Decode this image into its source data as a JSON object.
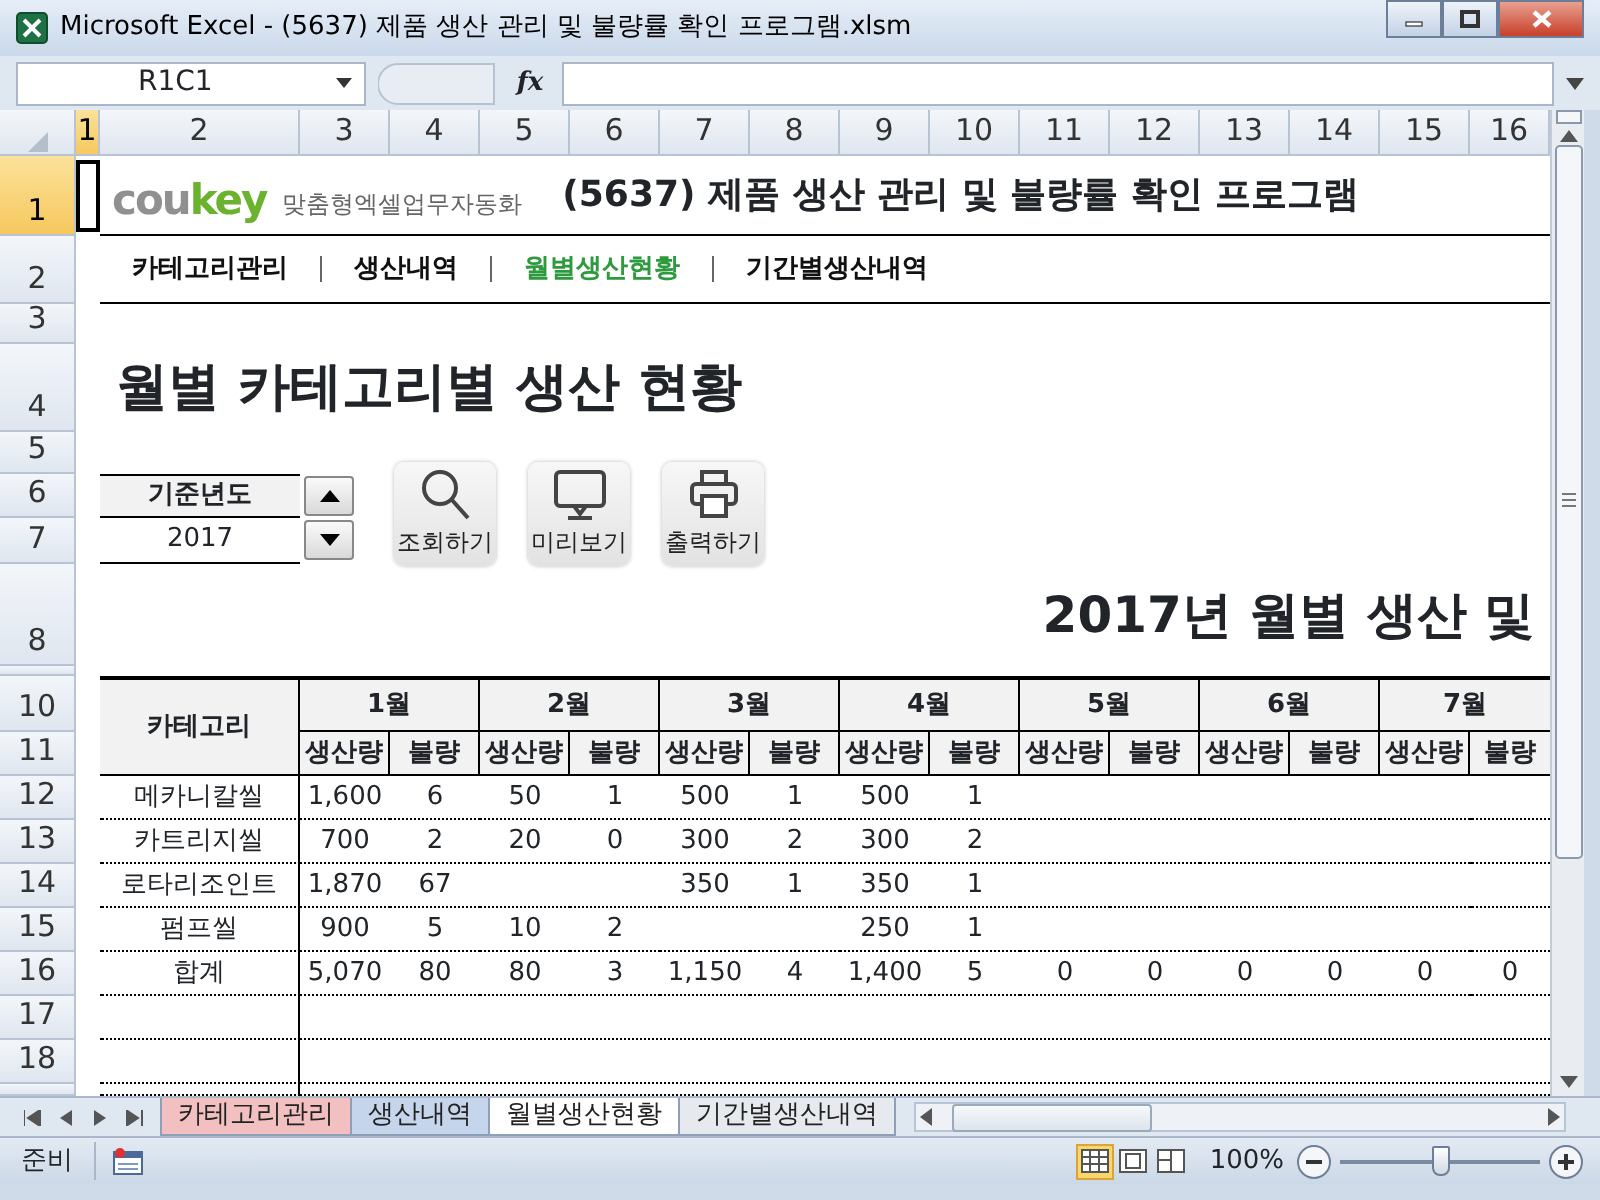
{
  "window": {
    "title": "Microsoft Excel - (5637) 제품 생산 관리 및 불량률 확인 프로그램.xlsm"
  },
  "formula_bar": {
    "name_box": "R1C1",
    "fx_label": "fx"
  },
  "column_headers": [
    {
      "label": "1",
      "selected": true
    },
    {
      "label": "2",
      "selected": false
    },
    {
      "label": "3",
      "selected": false
    },
    {
      "label": "4",
      "selected": false
    },
    {
      "label": "5",
      "selected": false
    },
    {
      "label": "6",
      "selected": false
    },
    {
      "label": "7",
      "selected": false
    },
    {
      "label": "8",
      "selected": false
    },
    {
      "label": "9",
      "selected": false
    },
    {
      "label": "10",
      "selected": false
    },
    {
      "label": "11",
      "selected": false
    },
    {
      "label": "12",
      "selected": false
    },
    {
      "label": "13",
      "selected": false
    },
    {
      "label": "14",
      "selected": false
    },
    {
      "label": "15",
      "selected": false
    },
    {
      "label": "16",
      "selected": false
    }
  ],
  "row_headers": [
    {
      "label": "1",
      "selected": true
    },
    {
      "label": "2",
      "selected": false
    },
    {
      "label": "3",
      "selected": false
    },
    {
      "label": "4",
      "selected": false
    },
    {
      "label": "5",
      "selected": false
    },
    {
      "label": "6",
      "selected": false
    },
    {
      "label": "7",
      "selected": false
    },
    {
      "label": "8",
      "selected": false
    },
    {
      "label": "10",
      "selected": false
    },
    {
      "label": "11",
      "selected": false
    },
    {
      "label": "12",
      "selected": false
    },
    {
      "label": "13",
      "selected": false
    },
    {
      "label": "14",
      "selected": false
    },
    {
      "label": "15",
      "selected": false
    },
    {
      "label": "16",
      "selected": false
    },
    {
      "label": "17",
      "selected": false
    },
    {
      "label": "18",
      "selected": false
    }
  ],
  "logo": {
    "brand": [
      "cou",
      "key"
    ],
    "tagline": "맞춤형엑셀업무자동화"
  },
  "program_title": "(5637) 제품 생산 관리 및 불량률 확인 프로그램",
  "nav": [
    {
      "label": "카테고리관리",
      "selected": false
    },
    {
      "label": "생산내역",
      "selected": false
    },
    {
      "label": "월별생산현황",
      "selected": true
    },
    {
      "label": "기간별생산내역",
      "selected": false
    }
  ],
  "heading": "월별 카테고리별 생산 현황",
  "year_picker": {
    "label": "기준년도",
    "value": "2017"
  },
  "actions": [
    {
      "kind": "search",
      "label": "조회하기"
    },
    {
      "kind": "preview",
      "label": "미리보기"
    },
    {
      "kind": "print",
      "label": "출력하기"
    }
  ],
  "report_title": "2017년 월별 생산 및",
  "table": {
    "category_header": "카테고리",
    "months": [
      {
        "label": "1월",
        "columns": [
          "생산량",
          "불량"
        ]
      },
      {
        "label": "2월",
        "columns": [
          "생산량",
          "불량"
        ]
      },
      {
        "label": "3월",
        "columns": [
          "생산량",
          "불량"
        ]
      },
      {
        "label": "4월",
        "columns": [
          "생산량",
          "불량"
        ]
      },
      {
        "label": "5월",
        "columns": [
          "생산량",
          "불량"
        ]
      },
      {
        "label": "6월",
        "columns": [
          "생산량",
          "불량"
        ]
      },
      {
        "label": "7월",
        "columns": [
          "생산량",
          "불량"
        ]
      }
    ],
    "rows": [
      {
        "category": "메카니칼씰",
        "cells": [
          "1,600",
          "6",
          "50",
          "1",
          "500",
          "1",
          "500",
          "1",
          null,
          null,
          null,
          null,
          null,
          null
        ]
      },
      {
        "category": "카트리지씰",
        "cells": [
          "700",
          "2",
          "20",
          "0",
          "300",
          "2",
          "300",
          "2",
          null,
          null,
          null,
          null,
          null,
          null
        ]
      },
      {
        "category": "로타리조인트",
        "cells": [
          "1,870",
          "67",
          null,
          null,
          "350",
          "1",
          "350",
          "1",
          null,
          null,
          null,
          null,
          null,
          null
        ]
      },
      {
        "category": "펌프씰",
        "cells": [
          "900",
          "5",
          "10",
          "2",
          null,
          null,
          "250",
          "1",
          null,
          null,
          null,
          null,
          null,
          null
        ]
      },
      {
        "category": "합계",
        "cells": [
          "5,070",
          "80",
          "80",
          "3",
          "1,150",
          "4",
          "1,400",
          "5",
          "0",
          "0",
          "0",
          "0",
          "0",
          "0"
        ]
      }
    ]
  },
  "sheet_tabs": [
    {
      "label": "카테고리관리",
      "color": "#f2c0c0",
      "selected": false
    },
    {
      "label": "생산내역",
      "color": "#c5d5ec",
      "selected": false
    },
    {
      "label": "월별생산현황",
      "selected": true
    },
    {
      "label": "기간별생산내역",
      "selected": false
    }
  ],
  "status_bar": {
    "mode": "준비",
    "views": [
      {
        "kind": "normal",
        "selected": true
      },
      {
        "kind": "layout",
        "selected": false
      },
      {
        "kind": "pagebreak",
        "selected": false
      }
    ],
    "zoom": "100%",
    "zoom_slider": {
      "level": 0.5
    }
  }
}
